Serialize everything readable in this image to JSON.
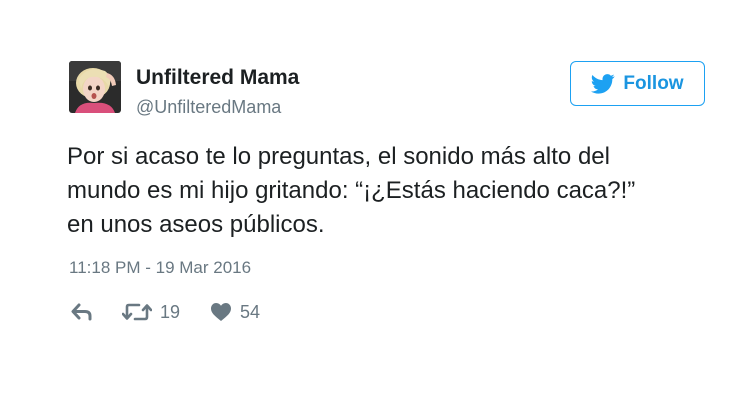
{
  "tweet": {
    "author": {
      "display_name": "Unfiltered Mama",
      "handle": "@UnfilteredMama",
      "avatar_icon": "woman-portrait-avatar"
    },
    "follow_button": {
      "label": "Follow",
      "icon": "twitter-bird-icon"
    },
    "text_lines": [
      "Por si acaso te lo preguntas, el sonido más alto del",
      "mundo es mi hijo gritando: “¡¿Estás haciendo caca?!”",
      "en unos aseos públicos."
    ],
    "timestamp": "11:18 PM - 19 Mar 2016",
    "actions": {
      "reply": {
        "icon": "reply-icon"
      },
      "retweet": {
        "icon": "retweet-icon",
        "count": "19"
      },
      "like": {
        "icon": "heart-icon",
        "count": "54"
      }
    }
  },
  "colors": {
    "text": "#1c2022",
    "muted": "#697882",
    "accent": "#1da1f2"
  }
}
